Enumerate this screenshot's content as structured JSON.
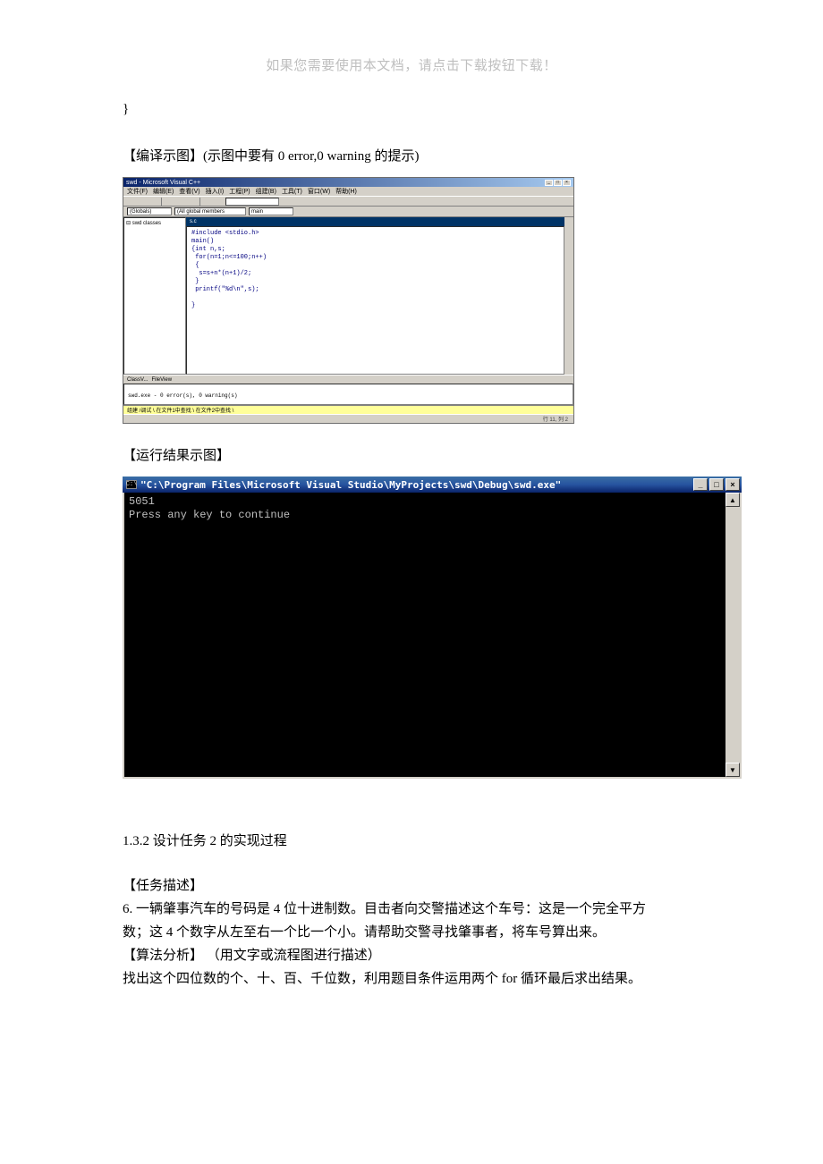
{
  "page_header": "如果您需要使用本文档，请点击下载按钮下载！",
  "brace_line": "}",
  "compile_label_cn_open": "【编译示图】",
  "compile_label_paren": "(示图中要有 0 error,0 warning 的提示)",
  "ide": {
    "title": "swd - Microsoft Visual C++",
    "menus": [
      "文件(F)",
      "编辑(E)",
      "查看(V)",
      "插入(I)",
      "工程(P)",
      "组建(B)",
      "工具(T)",
      "窗口(W)",
      "帮助(H)"
    ],
    "combo1": "(Globals)",
    "combo2": "(All global members",
    "combo3": "main",
    "tree_root": "swd classes",
    "editor_tab": "s.c",
    "code": "#include <stdio.h>\nmain()\n{int n,s;\n for(n=1;n<=100;n++)\n {\n  s=s+n*(n+1)/2;\n }\n printf(\"%d\\n\",s);\n\n}",
    "lower_tabs": [
      "ClassV...",
      "FileView"
    ],
    "output_line1": "",
    "output_line2": "swd.exe - 0 error(s), 0 warning(s)",
    "output_tabs": "组建 /调试 \\ 在文件1中查找 \\ 在文件2中查找 \\",
    "status_right": "行 11, 列 2"
  },
  "run_label": "【运行结果示图】",
  "console": {
    "title_prefix": "\"C:\\Program Files\\Microsoft Visual Studio\\MyProjects\\swd\\Debug\\swd.exe\"",
    "line1": "5051",
    "line2": "Press any key to continue"
  },
  "section132": "1.3.2 设计任务 2 的实现过程",
  "task_label": "【任务描述】",
  "task_body1": "6.  一辆肇事汽车的号码是 4 位十进制数。目击者向交警描述这个车号：这是一个完全平方",
  "task_body2": "数；这 4 个数字从左至右一个比一个小。请帮助交警寻找肇事者，将车号算出来。",
  "algo_label": "【算法分析】 （用文字或流程图进行描述）",
  "algo_body": "找出这个四位数的个、十、百、千位数，利用题目条件运用两个 for 循环最后求出结果。"
}
